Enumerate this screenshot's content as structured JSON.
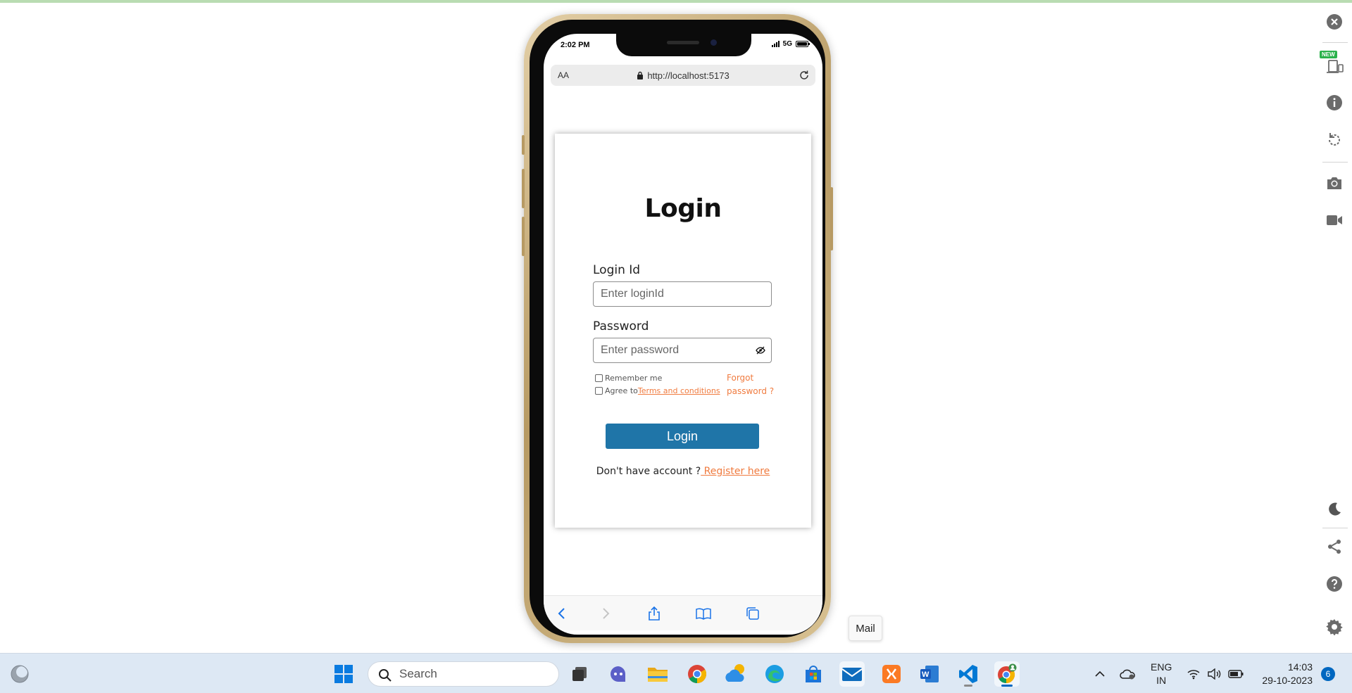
{
  "phone": {
    "status_time": "2:02 PM",
    "network": "5G",
    "url_text_size": "AA",
    "url": "http://localhost:5173"
  },
  "login": {
    "title": "Login",
    "login_id_label": "Login Id",
    "login_id_placeholder": "Enter loginId",
    "password_label": "Password",
    "password_placeholder": "Enter password",
    "remember_me": "Remember me",
    "agree_prefix": "Agree to",
    "terms_link": "Terms and conditions",
    "forgot_password": "Forgot password ?",
    "submit_label": "Login",
    "register_prompt": "Don't have account ?",
    "register_link": " Register here"
  },
  "sidebar": {
    "new_badge": "NEW",
    "icons": [
      "close-icon",
      "device-icon",
      "info-icon",
      "rotate-icon",
      "camera-icon",
      "video-icon",
      "moon-icon",
      "share-icon",
      "help-icon",
      "settings-icon"
    ]
  },
  "tooltip": {
    "text": "Mail"
  },
  "taskbar": {
    "search_placeholder": "Search",
    "language_line1": "ENG",
    "language_line2": "IN",
    "time": "14:03",
    "date": "29-10-2023",
    "notification_count": "6",
    "apps": [
      "task-view",
      "teams",
      "file-explorer",
      "chrome",
      "weather",
      "edge",
      "store",
      "mail",
      "xampp",
      "word",
      "vscode",
      "chrome-profile"
    ]
  },
  "colors": {
    "primary_button": "#1f75a8",
    "link": "#f07b3f",
    "taskbar_bg": "#dde8f4",
    "phone_frame": "#b79a63"
  }
}
